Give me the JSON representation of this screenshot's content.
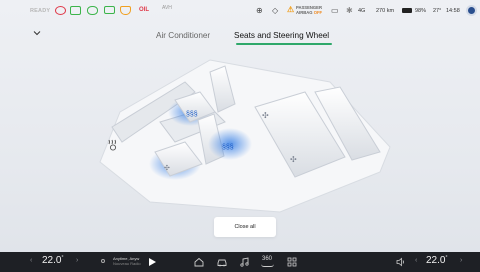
{
  "status_bar": {
    "ready": "READY",
    "oil_label": "OIL",
    "hold_label": "AVH",
    "airbag_line1": "PASSENGER",
    "airbag_line2": "AIRBAG",
    "airbag_state": "OFF",
    "signal": "4G",
    "range": "270 km",
    "battery": "98%",
    "outside_temp": "27°",
    "time": "14:58"
  },
  "header": {
    "tabs": [
      {
        "label": "Air Conditioner",
        "active": false
      },
      {
        "label": "Seats and Steering Wheel",
        "active": true
      }
    ]
  },
  "seats": {
    "front_left": "heated",
    "front_right": "heated",
    "front_vent": "ventilation",
    "rear": "ventilation",
    "steering_wheel": "heat-off"
  },
  "actions": {
    "close_all": "Close all"
  },
  "dock": {
    "left_temp": "22.0",
    "right_temp": "22.0",
    "unit": "°",
    "music_title": "Anytime, Anyw",
    "music_subtitle": "Nouveau Radio",
    "view360": "360"
  },
  "colors": {
    "accent": "#2fa86a",
    "heat": "#3b82e6",
    "dock_bg": "#1e2025"
  }
}
